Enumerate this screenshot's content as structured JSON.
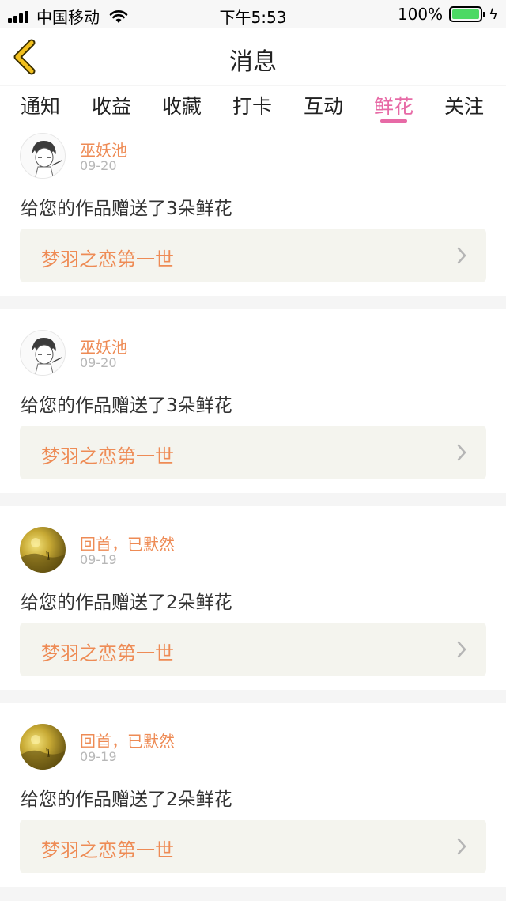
{
  "status_bar": {
    "carrier": "中国移动",
    "time": "下午5:53",
    "battery_percent": "100%",
    "battery_color": "#4cd964"
  },
  "nav": {
    "title": "消息",
    "back_icon": "chevron-left-icon",
    "accent_color": "#f2c01e"
  },
  "tabs": {
    "items": [
      {
        "label": "通知"
      },
      {
        "label": "收益"
      },
      {
        "label": "收藏"
      },
      {
        "label": "打卡"
      },
      {
        "label": "互动"
      },
      {
        "label": "鲜花"
      },
      {
        "label": "关注"
      }
    ],
    "active": "鲜花",
    "active_color": "#e76aa6"
  },
  "messages": [
    {
      "user": "巫妖池",
      "date": "09-20",
      "text": "给您的作品赠送了3朵鲜花",
      "work": "梦羽之恋第一世"
    },
    {
      "user": "巫妖池",
      "date": "09-20",
      "text": "给您的作品赠送了3朵鲜花",
      "work": "梦羽之恋第一世"
    },
    {
      "user": "回首，已默然",
      "date": "09-19",
      "text": "给您的作品赠送了2朵鲜花",
      "work": "梦羽之恋第一世"
    },
    {
      "user": "回首，已默然",
      "date": "09-19",
      "text": "给您的作品赠送了2朵鲜花",
      "work": "梦羽之恋第一世"
    }
  ],
  "colors": {
    "name": "#ee8b55",
    "link_bg": "#f4f4ee"
  }
}
